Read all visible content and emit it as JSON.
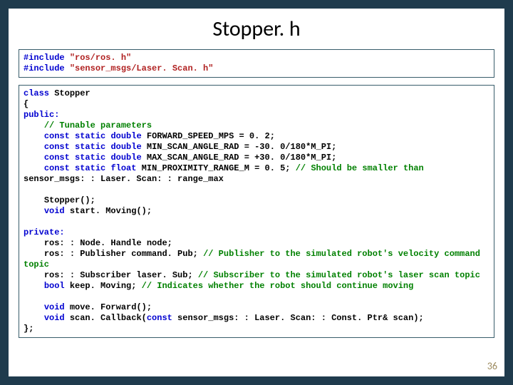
{
  "title": "Stopper. h",
  "includes": {
    "kw": "#include",
    "line1_str": "\"ros/ros. h\"",
    "line2_str": "\"sensor_msgs/Laser. Scan. h\""
  },
  "body": {
    "class_kw": "class",
    "class_name": " Stopper",
    "open_brace": "{",
    "public_kw": "public:",
    "comment_tunable": "// Tunable parameters",
    "const_kw": "const",
    "static_kw": "static",
    "double_kw": "double",
    "float_kw": "float",
    "line_fwd": " FORWARD_SPEED_MPS = 0. 2;",
    "line_min": " MIN_SCAN_ANGLE_RAD = -30. 0/180*M_PI;",
    "line_max": " MAX_SCAN_ANGLE_RAD = +30. 0/180*M_PI;",
    "line_prox": " MIN_PROXIMITY_RANGE_M = 0. 5; ",
    "comment_smaller_a": "// Should be smaller than",
    "sensor_msgs_line": "sensor_msgs: : Laser. Scan: : range_max",
    "ctor": "    Stopper();",
    "void_kw": "void",
    "startmoving": " start. Moving();",
    "private_kw": "private:",
    "ros_node": "    ros: : Node. Handle node;",
    "ros_pub_a": "    ros: : Publisher command. Pub; ",
    "ros_pub_cmt": "// Publisher to the simulated robot's velocity command topic",
    "ros_sub_a": "    ros: : Subscriber laser. Sub; ",
    "ros_sub_cmt": "// Subscriber to the simulated robot's laser scan topic",
    "bool_kw": "bool",
    "keep_a": " keep. Moving; ",
    "keep_cmt": "// Indicates whether the robot should continue moving",
    "move_fwd": " move. Forward();",
    "scan_cb_a": " scan. Callback(",
    "scan_cb_b": " sensor_msgs: : Laser. Scan: : Const. Ptr& scan);",
    "close": "};"
  },
  "pagenum": "36"
}
